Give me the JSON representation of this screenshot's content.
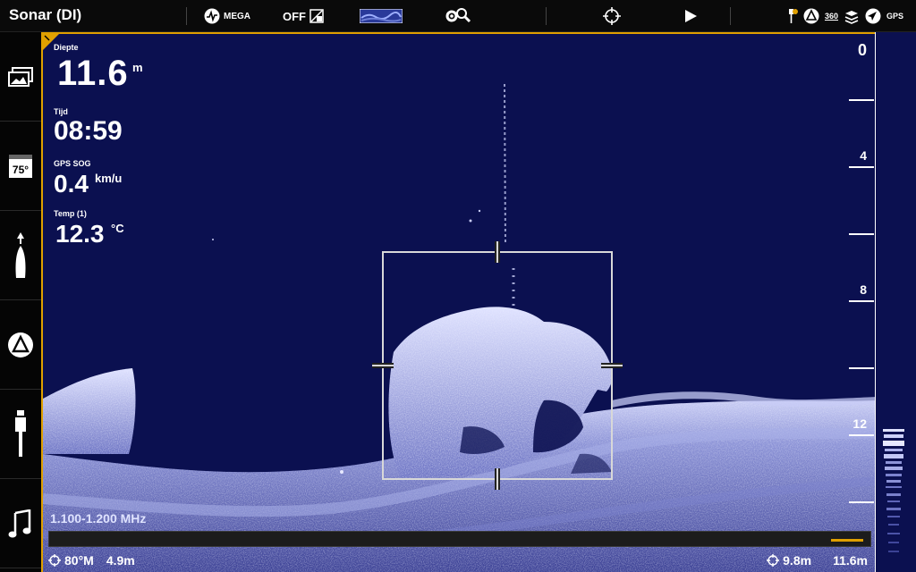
{
  "header": {
    "title": "Sonar (DI)",
    "mega_label": "MEGA",
    "off_label": "OFF",
    "gps_label": "GPS",
    "label_360": "360"
  },
  "readouts": {
    "depth": {
      "label": "Diepte",
      "value": "11.6",
      "unit": "m"
    },
    "time": {
      "label": "Tijd",
      "value": "08:59"
    },
    "sog": {
      "label": "GPS SOG",
      "value": "0.4",
      "unit": "km/u"
    },
    "temp": {
      "label": "Temp (1)",
      "value": "12.3",
      "unit": "°C"
    }
  },
  "sidebar": {
    "temp_badge": "75°"
  },
  "sonar": {
    "frequency": "1.100-1.200 MHz",
    "heading": "80°M",
    "cursor_distance": "4.9m",
    "cursor_depth": "9.8m",
    "bottom_depth": "11.6m"
  },
  "scale": {
    "labels": [
      "0",
      "4",
      "8",
      "12"
    ]
  },
  "colors": {
    "accent": "#e0a000",
    "background": "#0b1050",
    "sonar_return": "#c7cbf5"
  }
}
